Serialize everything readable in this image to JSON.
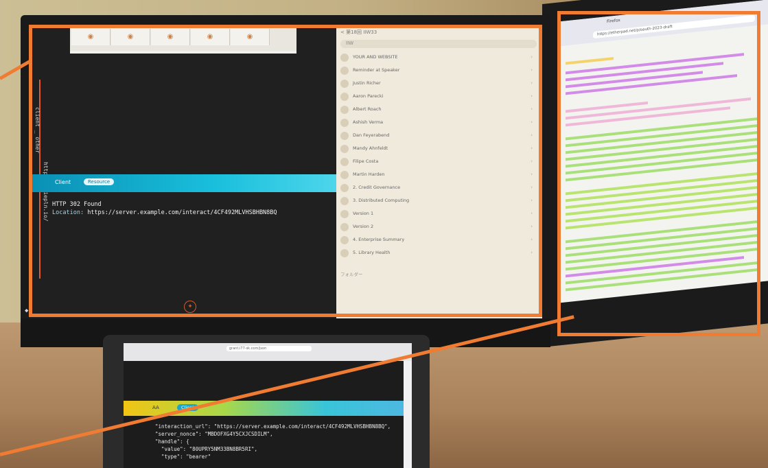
{
  "main_screen": {
    "left_pane": {
      "vertical_label_1": "client _ other",
      "vertical_label_2": "https://tiepln.io/",
      "band": {
        "left_label": "Client",
        "pill_label": "Resource"
      },
      "http_status": "HTTP 302 Found",
      "http_location_key": "Location:",
      "http_location_value": "https://server.example.com/interact/4CF492MLVHSBHBN8BQ"
    },
    "right_pane": {
      "header": "< 第18回 IIW33",
      "search_placeholder": "IIW",
      "items": [
        "YOUR AND WEBSITE",
        "Reminder at Speaker",
        "Justin Richer",
        "Aaron Parecki",
        "Albert Roach",
        "Ashish Verma",
        "Dan Feyerabend",
        "Mandy Ahnfeldt",
        "Filipe Costa",
        "Martin Harden",
        "2. Credit Governance",
        "3. Distributed Computing",
        "Version 1",
        "Version 2",
        "4. Enterprise Summary",
        "5. Library Health"
      ],
      "footer": "フォルダー"
    }
  },
  "right_screen": {
    "browser_tab": "Firefox",
    "url": "https://etherpad.net/p/oauth-2023-draft"
  },
  "laptop_screen": {
    "url": "grant.i77-sk.com/json",
    "band": {
      "left_label": "AA",
      "pill_label": "Client"
    },
    "json_lines": [
      "\"interaction_url\": \"https://server.example.com/interact/4CF492MLVHSBHBN8BQ\",",
      "\"server_nonce\": \"MBDOFXG4Y5CXJCSDILM\",",
      "\"handle\": {",
      "  \"value\": \"80UPRY5NM33BN8BR5RI\",",
      "  \"type\": \"bearer\""
    ]
  },
  "colors": {
    "callout": "#f07c33",
    "band_cyan": "#19bfdc",
    "status_text": "#f2f2f2"
  }
}
